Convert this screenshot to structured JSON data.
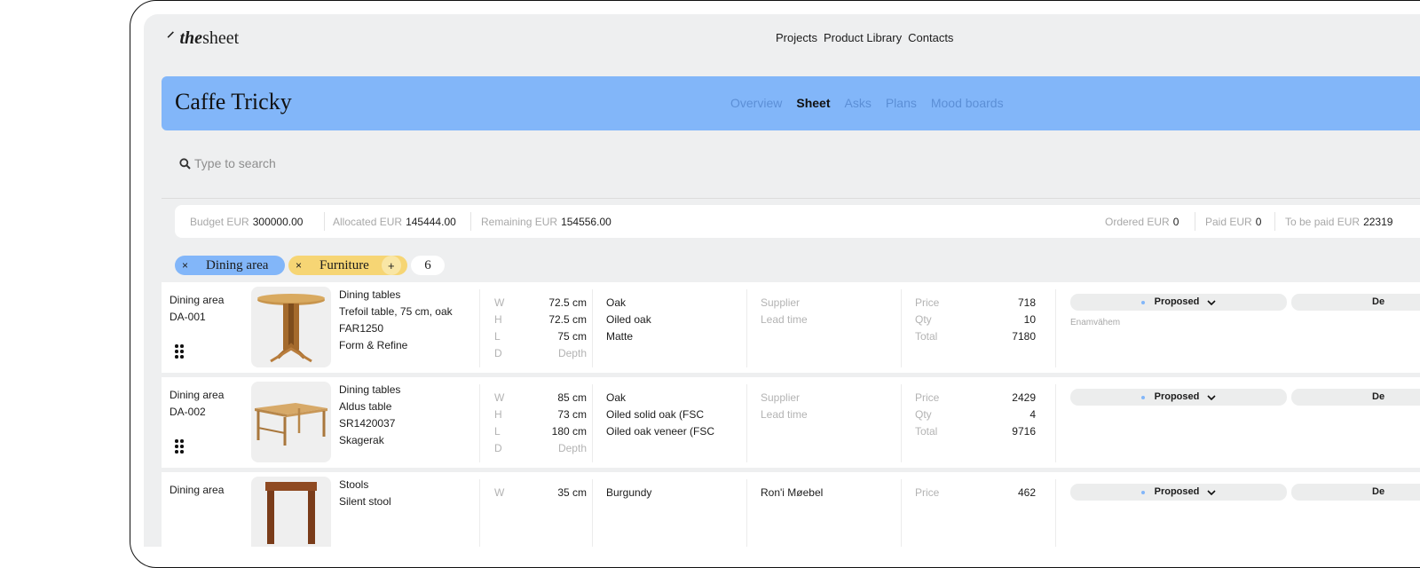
{
  "logo": {
    "mark": "⸍",
    "italic": "the",
    "rest": "sheet"
  },
  "topnav": [
    "Projects",
    "Product Library",
    "Contacts"
  ],
  "project": {
    "title": "Caffe Tricky",
    "tabs": [
      "Overview",
      "Sheet",
      "Asks",
      "Plans",
      "Mood boards"
    ],
    "active_tab": "Sheet"
  },
  "search": {
    "placeholder": "Type to search"
  },
  "budget": {
    "budget": {
      "label": "Budget",
      "currency": "EUR",
      "value": "300000.00"
    },
    "allocated": {
      "label": "Allocated",
      "currency": "EUR",
      "value": "145444.00"
    },
    "remaining": {
      "label": "Remaining",
      "currency": "EUR",
      "value": "154556.00"
    },
    "ordered": {
      "label": "Ordered",
      "currency": "EUR",
      "value": "0"
    },
    "paid": {
      "label": "Paid",
      "currency": "EUR",
      "value": "0"
    },
    "to_be_paid": {
      "label": "To be paid",
      "currency": "EUR",
      "value": "22319"
    }
  },
  "filters": {
    "chips": [
      {
        "label": "Dining area",
        "remove": "×"
      },
      {
        "label": "Furniture",
        "remove": "×",
        "add": "+"
      }
    ],
    "count": "6"
  },
  "colors": {
    "accent_blue": "#82b6f9",
    "accent_yellow": "#f6d574",
    "background": "#eeeff0"
  },
  "dim_labels": [
    "W",
    "H",
    "L",
    "D"
  ],
  "price_labels": [
    "Price",
    "Qty",
    "Total"
  ],
  "supplier_labels": [
    "Supplier",
    "Lead time"
  ],
  "rows": [
    {
      "area": "Dining area",
      "code": "DA-001",
      "category": "Dining tables",
      "name": "Trefoil table, 75 cm, oak",
      "sku": "FAR1250",
      "brand": "Form & Refine",
      "image_icon": "round-table-icon",
      "dims": [
        "72.5 cm",
        "72.5 cm",
        "75 cm",
        "Depth"
      ],
      "materials": [
        "Oak",
        "Oiled oak",
        "Matte"
      ],
      "supplier": "",
      "price": "718",
      "qty": "10",
      "total": "7180",
      "status": "Proposed",
      "status2": "De",
      "note": "Enamvähem"
    },
    {
      "area": "Dining area",
      "code": "DA-002",
      "category": "Dining tables",
      "name": "Aldus table",
      "sku": "SR1420037",
      "brand": "Skagerak",
      "image_icon": "rect-table-icon",
      "dims": [
        "85 cm",
        "73 cm",
        "180 cm",
        "Depth"
      ],
      "materials": [
        "Oak",
        "Oiled solid oak (FSC",
        "Oiled oak veneer (FSC"
      ],
      "supplier": "",
      "price": "2429",
      "qty": "4",
      "total": "9716",
      "status": "Proposed",
      "status2": "De",
      "note": ""
    },
    {
      "area": "Dining area",
      "code": "",
      "category": "Stools",
      "name": "Silent stool",
      "sku": "",
      "brand": "",
      "image_icon": "stool-icon",
      "dims": [
        "35 cm",
        "",
        "",
        ""
      ],
      "materials": [
        "Burgundy",
        "",
        ""
      ],
      "supplier": "Ron'i Møebel",
      "price": "462",
      "qty": "",
      "total": "",
      "status": "Proposed",
      "status2": "De",
      "note": ""
    }
  ]
}
